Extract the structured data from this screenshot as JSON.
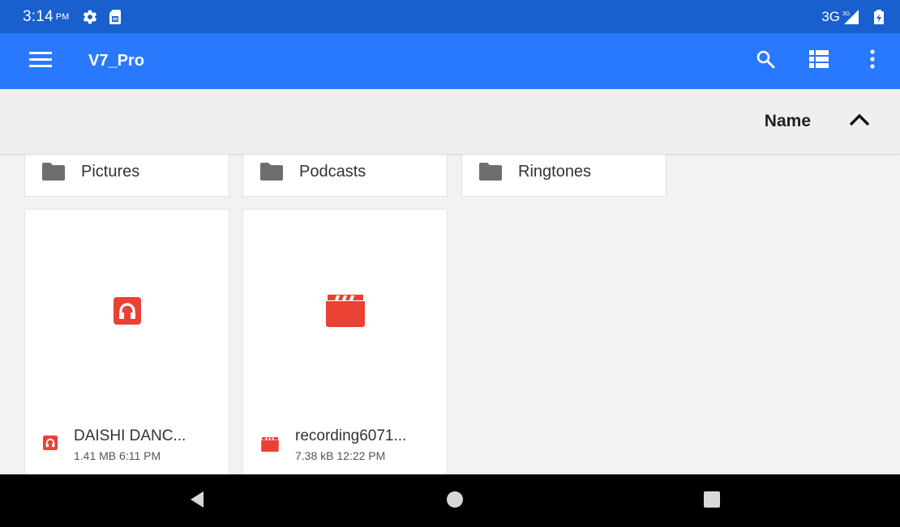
{
  "status_bar": {
    "time": "3:14",
    "ampm": "PM",
    "network": "3G",
    "icons": [
      "settings-gear-icon",
      "sd-card-icon",
      "signal-icon",
      "battery-icon"
    ]
  },
  "app_bar": {
    "title": "V7_Pro",
    "color": "#2979ff",
    "icons": [
      "menu-icon",
      "search-icon",
      "list-view-icon",
      "more-vert-icon"
    ]
  },
  "sort": {
    "label": "Name",
    "direction_icon": "chevron-up-icon"
  },
  "folders": [
    {
      "name": "Pictures",
      "icon": "folder-icon"
    },
    {
      "name": "Podcasts",
      "icon": "folder-icon"
    },
    {
      "name": "Ringtones",
      "icon": "folder-icon"
    }
  ],
  "files": [
    {
      "name": "DAISHI DANC...",
      "size": "1.41 MB",
      "time": "6:11 PM",
      "details": "1.41 MB 6:11 PM",
      "icon": "headphones-audio-icon",
      "icon_color": "#e94235"
    },
    {
      "name": "recording6071...",
      "size": "7.38 kB",
      "time": "12:22 PM",
      "details": "7.38 kB 12:22 PM",
      "icon": "video-clapper-icon",
      "icon_color": "#e94235"
    }
  ],
  "nav_bar": {
    "icons": [
      "back-icon",
      "home-icon",
      "recents-icon"
    ]
  }
}
